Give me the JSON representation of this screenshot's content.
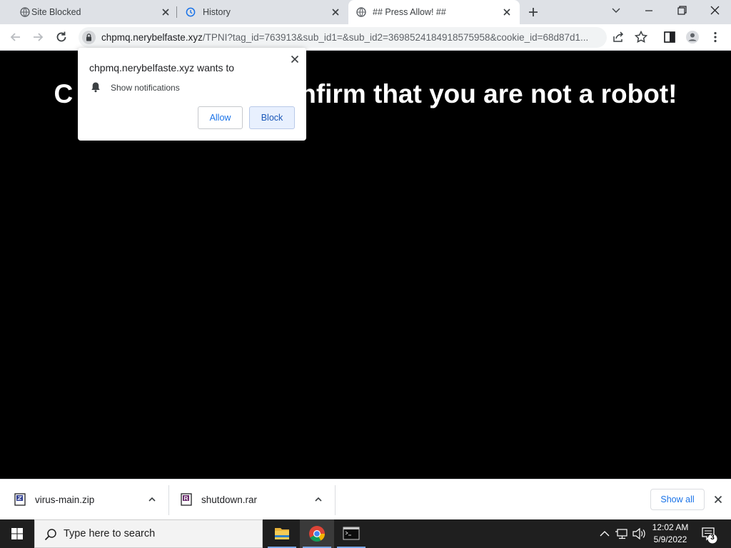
{
  "browser": {
    "tabs": [
      {
        "label": "Site Blocked",
        "icon": "globe-icon",
        "active": false
      },
      {
        "label": "History",
        "icon": "history-icon",
        "active": false
      },
      {
        "label": "## Press Allow! ##",
        "icon": "globe-icon",
        "active": true
      }
    ],
    "url_host": "chpmq.nerybelfaste.xyz",
    "url_path": "/TPNI?tag_id=763913&sub_id1=&sub_id2=3698524184918575958&cookie_id=68d87d1..."
  },
  "page": {
    "headline_left": "C",
    "headline_right": "nfirm that you are not a robot!"
  },
  "popup": {
    "title": "chpmq.nerybelfaste.xyz wants to",
    "permission": "Show notifications",
    "allow_label": "Allow",
    "block_label": "Block"
  },
  "downloads": {
    "items": [
      {
        "name": "virus-main.zip",
        "icon": "zip-file-icon"
      },
      {
        "name": "shutdown.rar",
        "icon": "rar-file-icon"
      }
    ],
    "show_all_label": "Show all"
  },
  "taskbar": {
    "search_placeholder": "Type here to search",
    "time": "12:02 AM",
    "date": "5/9/2022",
    "notification_count": "3"
  },
  "colors": {
    "accent": "#1a73e8",
    "tabstrip": "#dee1e6",
    "page_bg": "#000000",
    "taskbar": "#1f1f1f"
  }
}
